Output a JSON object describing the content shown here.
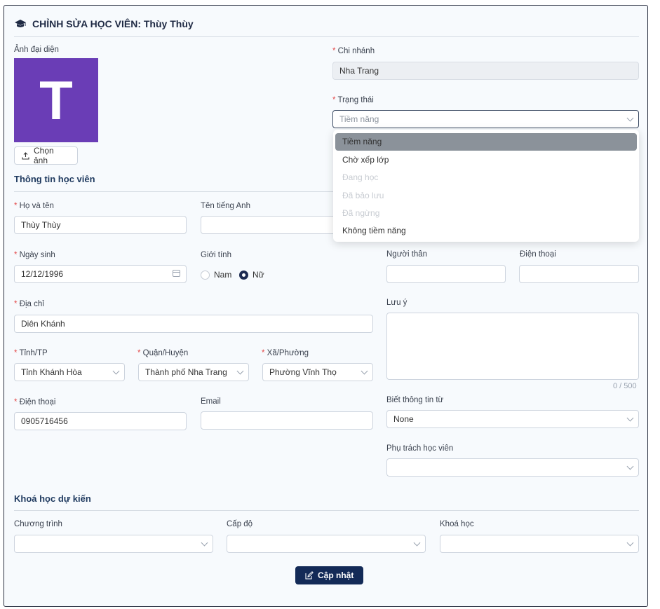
{
  "header": {
    "title": "CHỈNH SỬA HỌC VIÊN: Thùy Thùy"
  },
  "avatar": {
    "label": "Ảnh đại diện",
    "initial": "T",
    "color": "#6a3db6",
    "upload_label": "Chọn ảnh"
  },
  "branch": {
    "label": "Chi nhánh",
    "value": "Nha Trang"
  },
  "status": {
    "label": "Trạng thái",
    "placeholder": "Tiềm năng",
    "options": [
      {
        "label": "Tiềm năng",
        "state": "selected"
      },
      {
        "label": "Chờ xếp lớp",
        "state": "enabled"
      },
      {
        "label": "Đang học",
        "state": "disabled"
      },
      {
        "label": "Đã bảo lưu",
        "state": "disabled"
      },
      {
        "label": "Đã ngừng",
        "state": "disabled"
      },
      {
        "label": "Không tiềm năng",
        "state": "enabled"
      }
    ]
  },
  "student_section": {
    "title": "Thông tin học viên"
  },
  "fields": {
    "full_name": {
      "label": "Họ và tên",
      "value": "Thùy Thùy"
    },
    "english_name": {
      "label": "Tên tiếng Anh",
      "value": ""
    },
    "dob": {
      "label": "Ngày sinh",
      "value": "12/12/1996"
    },
    "gender": {
      "label": "Giới tính",
      "options": [
        "Nam",
        "Nữ"
      ],
      "selected": "Nữ"
    },
    "relative": {
      "label": "Người thân",
      "value": ""
    },
    "relative_phone": {
      "label": "Điện thoại",
      "value": ""
    },
    "address": {
      "label": "Địa chỉ",
      "value": "Diên Khánh"
    },
    "note": {
      "label": "Lưu ý",
      "value": "",
      "counter": "0 / 500"
    },
    "province": {
      "label": "Tỉnh/TP",
      "value": "Tỉnh Khánh Hòa"
    },
    "district": {
      "label": "Quận/Huyện",
      "value": "Thành phố Nha Trang"
    },
    "ward": {
      "label": "Xã/Phường",
      "value": "Phường Vĩnh Thọ"
    },
    "phone": {
      "label": "Điện thoại",
      "value": "0905716456"
    },
    "email": {
      "label": "Email",
      "value": ""
    },
    "source": {
      "label": "Biết thông tin từ",
      "value": "None"
    },
    "manager": {
      "label": "Phụ trách học viên",
      "value": ""
    }
  },
  "course_section": {
    "title": "Khoá học dự kiến",
    "program": {
      "label": "Chương trình",
      "value": ""
    },
    "level": {
      "label": "Cấp độ",
      "value": ""
    },
    "course": {
      "label": "Khoá học",
      "value": ""
    }
  },
  "submit": {
    "label": "Cập nhật"
  },
  "colors": {
    "primary": "#132a57",
    "required": "#e34a4a",
    "avatar": "#6a3db6"
  }
}
